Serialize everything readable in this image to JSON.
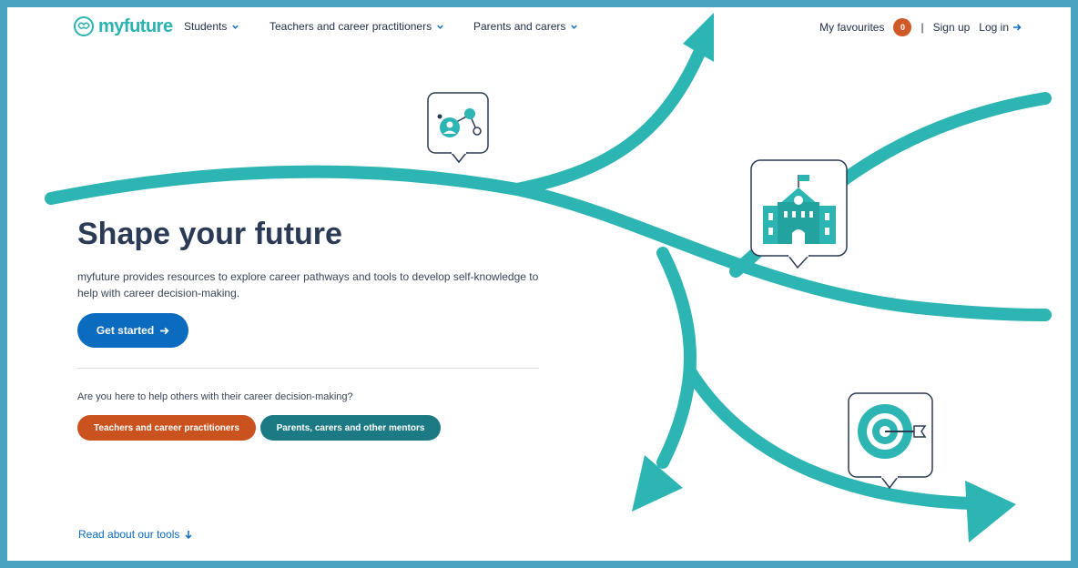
{
  "brand": {
    "name": "myfuture",
    "logo_icon": "brain-icon"
  },
  "nav": {
    "items": [
      {
        "label": "Students",
        "icon": "chevron-down-icon"
      },
      {
        "label": "Teachers and career practitioners",
        "icon": "chevron-down-icon"
      },
      {
        "label": "Parents and carers",
        "icon": "chevron-down-icon"
      }
    ],
    "favourites_label": "My favourites",
    "favourites_count": "0",
    "separator": "|",
    "signup_label": "Sign up",
    "login_label": "Log in"
  },
  "hero": {
    "title": "Shape your future",
    "description": "myfuture provides resources to explore career pathways and tools to develop self-knowledge to help with career decision-making.",
    "cta_label": "Get started"
  },
  "helpers": {
    "question": "Are you here to help others with their career decision-making?",
    "teachers_label": "Teachers and career practitioners",
    "parents_label": "Parents, carers and other mentors"
  },
  "footer_link": {
    "label": "Read about our tools"
  },
  "illustration": {
    "icons": [
      "person-network-icon",
      "school-building-icon",
      "target-icon"
    ]
  },
  "colors": {
    "teal": "#2cb5b2",
    "primary_blue": "#0a6bbf",
    "orange": "#c9521f",
    "dark_teal": "#1b7a83",
    "navy_text": "#2b3a55",
    "frame": "#4aa3c1"
  }
}
